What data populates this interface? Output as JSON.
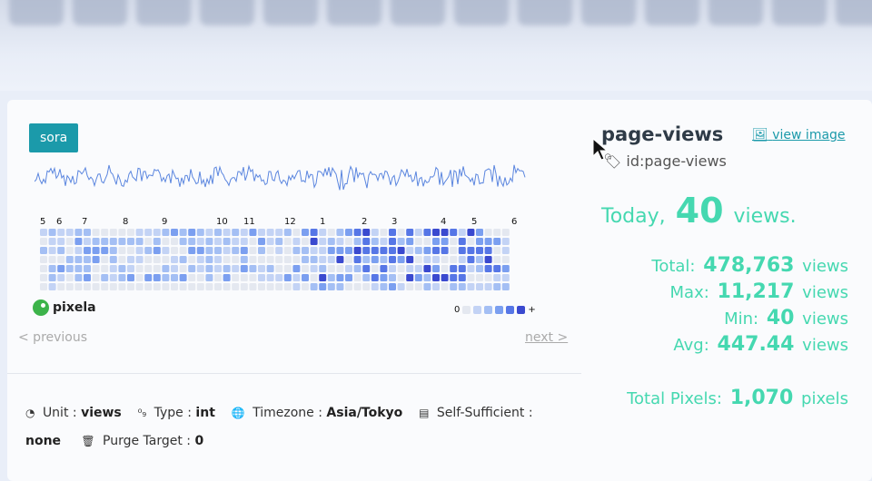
{
  "graph_tag": "sora",
  "month_labels": [
    "5",
    "6",
    "7",
    "8",
    "9",
    "10",
    "11",
    "12",
    "1",
    "2",
    "3",
    "4",
    "5",
    "6"
  ],
  "brand": "pixela",
  "legend": {
    "min_label": "0",
    "max_label": "+"
  },
  "colors": {
    "accent": "#1b9aaa",
    "stats": "#45d8b0",
    "levels": [
      "#e4e8f0",
      "#c3d3f5",
      "#a4bff4",
      "#7b9ff0",
      "#5676e6",
      "#3a49cf"
    ]
  },
  "nav": {
    "previous": "< previous",
    "next": "next >"
  },
  "meta": {
    "unit_label": "Unit",
    "unit_value": "views",
    "type_label": "Type",
    "type_value": "int",
    "timezone_label": "Timezone",
    "timezone_value": "Asia/Tokyo",
    "self_sufficient_label": "Self-Sufficient",
    "self_sufficient_value": "none",
    "purge_target_label": "Purge Target",
    "purge_target_value": "0"
  },
  "graph": {
    "name": "page-views",
    "id_text": "id:page-views",
    "view_image": "view image"
  },
  "stats": {
    "today_prefix": "Today,",
    "today_value": "40",
    "today_suffix": "views.",
    "total_label": "Total:",
    "total_value": "478,763",
    "total_unit": "views",
    "max_label": "Max:",
    "max_value": "11,217",
    "max_unit": "views",
    "min_label": "Min:",
    "min_value": "40",
    "min_unit": "views",
    "avg_label": "Avg:",
    "avg_value": "447.44",
    "avg_unit": "views",
    "pixels_label": "Total Pixels:",
    "pixels_value": "1,070",
    "pixels_unit": "pixels"
  }
}
